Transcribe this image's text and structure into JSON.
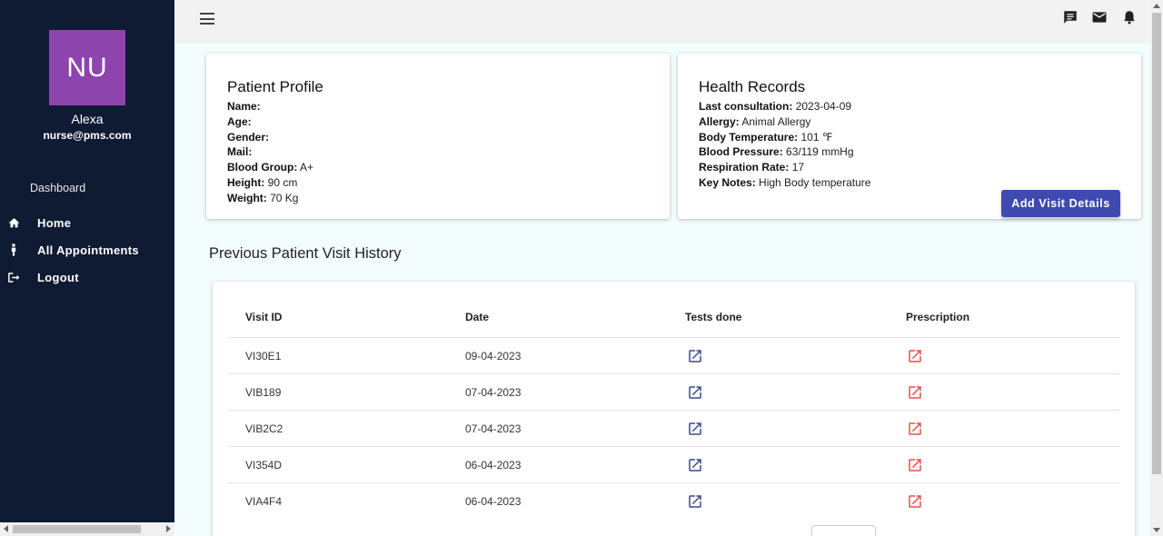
{
  "sidebar": {
    "avatar_initials": "NU",
    "user_name": "Alexa",
    "user_email": "nurse@pms.com",
    "section_label": "Dashboard",
    "items": [
      {
        "label": "Home",
        "icon": "home-icon"
      },
      {
        "label": "All Appointments",
        "icon": "person-icon"
      },
      {
        "label": "Logout",
        "icon": "logout-icon"
      }
    ]
  },
  "topbar": {
    "icons": [
      "menu-icon",
      "chat-icon",
      "mail-icon",
      "bell-icon"
    ]
  },
  "patient_profile": {
    "title": "Patient Profile",
    "fields": [
      {
        "label": "Name:",
        "value": ""
      },
      {
        "label": "Age:",
        "value": ""
      },
      {
        "label": "Gender:",
        "value": ""
      },
      {
        "label": "Mail:",
        "value": ""
      },
      {
        "label": "Blood Group:",
        "value": "A+"
      },
      {
        "label": "Height:",
        "value": "90 cm"
      },
      {
        "label": "Weight:",
        "value": "70 Kg"
      }
    ]
  },
  "health_records": {
    "title": "Health Records",
    "fields": [
      {
        "label": "Last consultation:",
        "value": "2023-04-09"
      },
      {
        "label": "Allergy:",
        "value": "Animal Allergy"
      },
      {
        "label": "Body Temperature:",
        "value": "101 ℉"
      },
      {
        "label": "Blood Pressure:",
        "value": "63/119 mmHg"
      },
      {
        "label": "Respiration Rate:",
        "value": "17"
      },
      {
        "label": "Key Notes:",
        "value": "High Body temperature"
      }
    ],
    "button_label": "Add Visit Details"
  },
  "history": {
    "title": "Previous Patient Visit History",
    "columns": [
      "Visit ID",
      "Date",
      "Tests done",
      "Prescription"
    ],
    "rows": [
      {
        "visit_id": "VI30E1",
        "date": "09-04-2023"
      },
      {
        "visit_id": "VIB189",
        "date": "07-04-2023"
      },
      {
        "visit_id": "VIB2C2",
        "date": "07-04-2023"
      },
      {
        "visit_id": "VI354D",
        "date": "06-04-2023"
      },
      {
        "visit_id": "VIA4F4",
        "date": "06-04-2023"
      }
    ]
  },
  "colors": {
    "sidebar_bg": "#0f1a33",
    "avatar_bg": "#8e44ad",
    "primary_button": "#3f4ab0",
    "tests_icon": "#3a4a8c",
    "prescription_icon": "#e0524a",
    "page_bg": "#f4fdfd"
  }
}
